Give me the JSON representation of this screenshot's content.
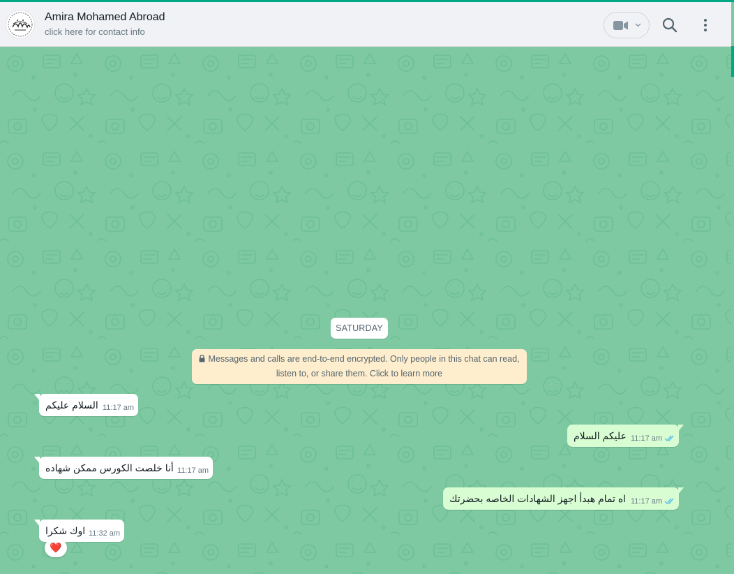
{
  "header": {
    "contact_name": "Amira Mohamed Abroad",
    "contact_subtitle": "click here for contact info"
  },
  "icons": {
    "avatar": "calligraphy-logo",
    "video": "video-camera-icon",
    "search": "search-icon",
    "menu": "kebab-menu-icon",
    "lock": "lock-icon",
    "read_receipt": "double-check-icon"
  },
  "colors": {
    "accent": "#00a884",
    "wallpaper": "#7ec9a2",
    "incoming": "#ffffff",
    "outgoing": "#d9fdd3",
    "ticks": "#53bdeb",
    "encryption_notice": "#ffeecd",
    "reaction_heart": "#e0245e"
  },
  "chat": {
    "date_divider": "SATURDAY",
    "encryption_line1": "Messages and calls are end-to-end encrypted. Only people in this chat can read,",
    "encryption_line2": "listen to, or share them. Click to learn more",
    "messages": [
      {
        "direction": "in",
        "text": "السلام عليكم",
        "time": "11:17 am"
      },
      {
        "direction": "out",
        "text": "عليكم السلام",
        "time": "11:17 am",
        "read": true
      },
      {
        "direction": "in",
        "text": "أنا خلصت الكورس ممكن شهاده",
        "time": "11:17 am"
      },
      {
        "direction": "out",
        "text": "اه تمام هبدأ اجهز الشهادات الخاصه بحضرتك",
        "time": "11:17 am",
        "read": true
      },
      {
        "direction": "in",
        "text": "اوك شكرا",
        "time": "11:32 am",
        "reaction": "❤️"
      }
    ]
  }
}
